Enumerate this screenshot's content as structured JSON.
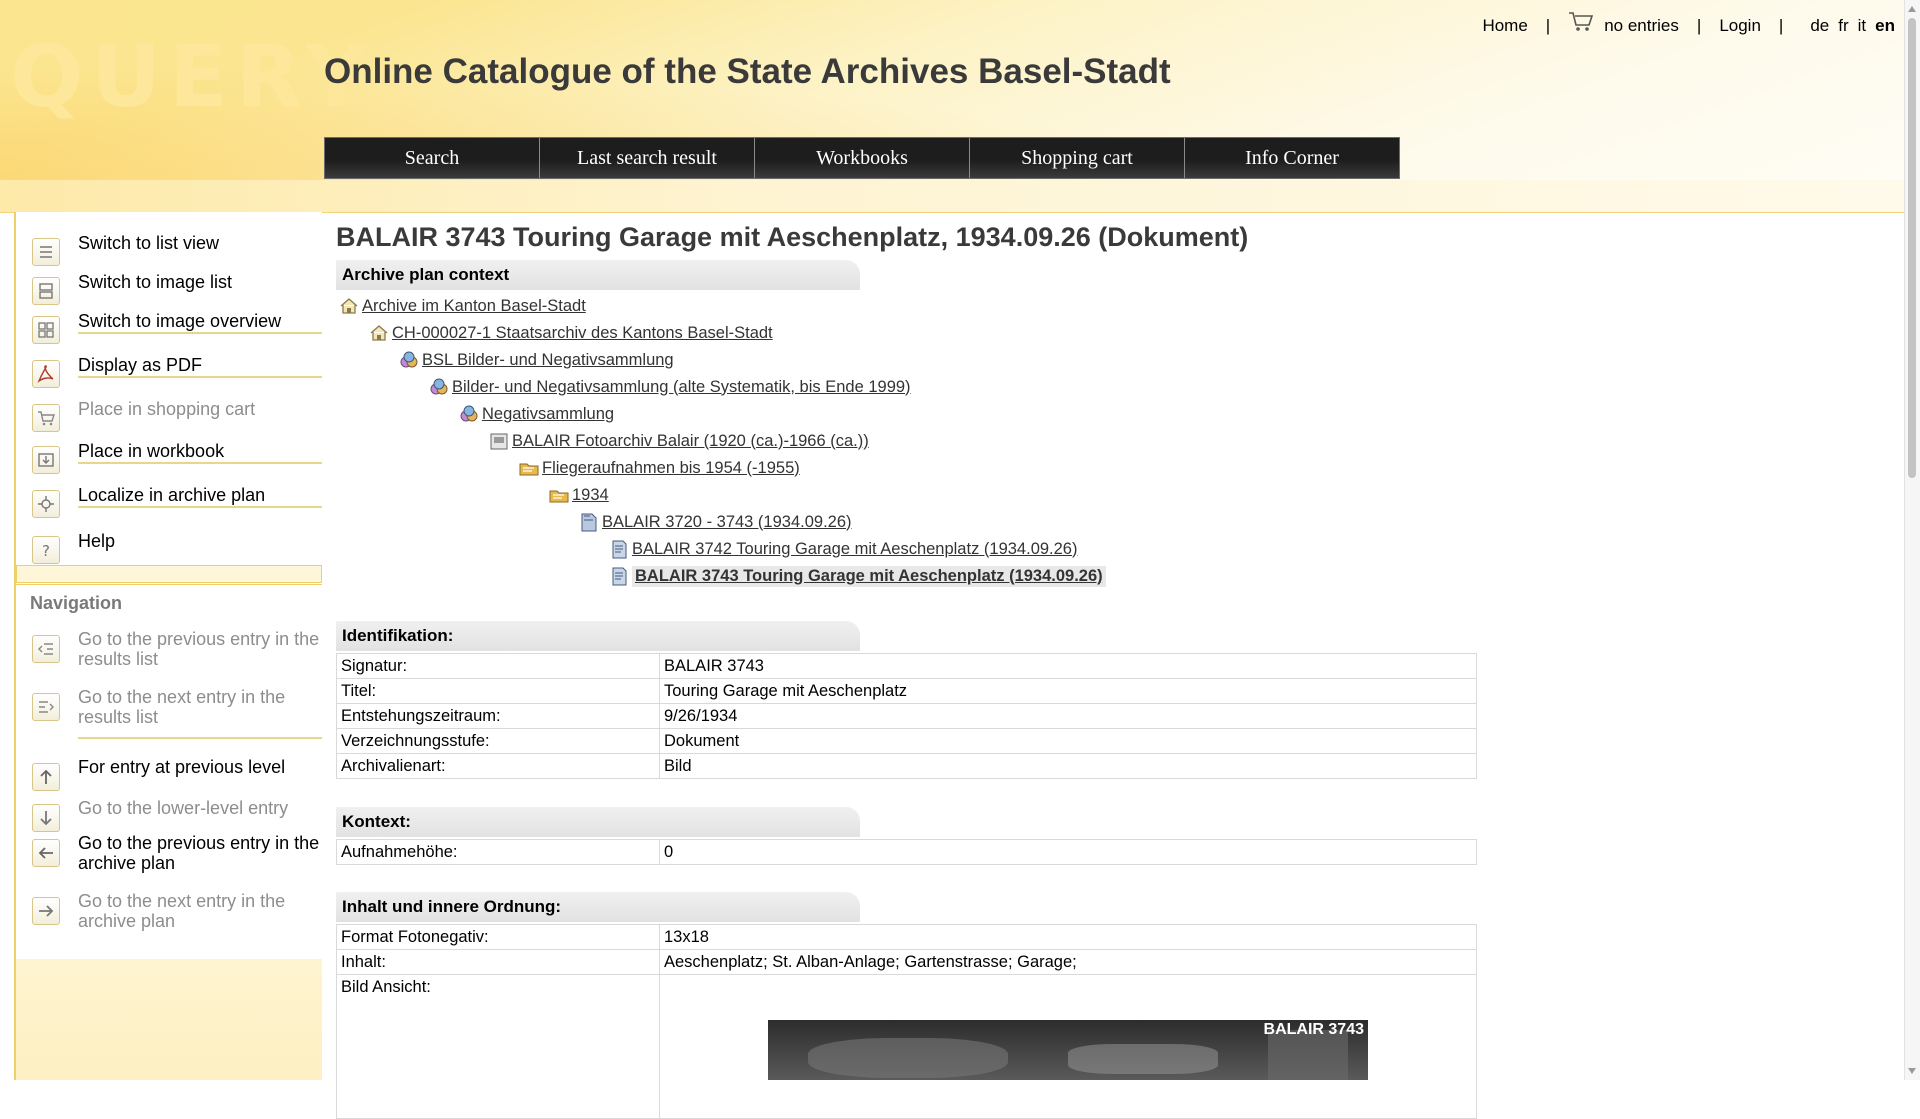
{
  "header": {
    "logo_text": "QUERY",
    "site_title": "Online Catalogue of the State Archives Basel-Stadt",
    "top_links": {
      "home": "Home",
      "separator": "|",
      "cart_status": "no entries",
      "login": "Login",
      "languages": [
        "de",
        "fr",
        "it",
        "en"
      ],
      "active_language": "en"
    },
    "nav_tabs": [
      "Search",
      "Last search result",
      "Workbooks",
      "Shopping cart",
      "Info Corner"
    ]
  },
  "sidebar": {
    "actions": [
      {
        "label": "Switch to list view",
        "icon": "list-view-icon",
        "enabled": true
      },
      {
        "label": "Switch to image list",
        "icon": "image-list-icon",
        "enabled": true
      },
      {
        "label": "Switch to image overview",
        "icon": "image-overview-icon",
        "enabled": true
      },
      {
        "label": "Display as PDF",
        "icon": "pdf-icon",
        "enabled": true
      },
      {
        "label": "Place in shopping cart",
        "icon": "cart-add-icon",
        "enabled": false
      },
      {
        "label": "Place in workbook",
        "icon": "workbook-add-icon",
        "enabled": true
      },
      {
        "label": "Localize in archive plan",
        "icon": "localize-icon",
        "enabled": true
      },
      {
        "label": "Help",
        "icon": "help-icon",
        "enabled": true
      }
    ],
    "navigation_heading": "Navigation",
    "navigation": [
      {
        "label": "Go to the previous entry in the results list",
        "icon": "prev-result-icon",
        "enabled": false
      },
      {
        "label": "Go to the next entry in the results list",
        "icon": "next-result-icon",
        "enabled": false
      },
      {
        "label": "For entry at previous level",
        "icon": "level-up-icon",
        "enabled": true
      },
      {
        "label": "Go to the lower-level entry",
        "icon": "level-down-icon",
        "enabled": false
      },
      {
        "label": "Go to the previous entry in the archive plan",
        "icon": "arrow-left-icon",
        "enabled": true
      },
      {
        "label": "Go to the next entry in the archive plan",
        "icon": "arrow-right-icon",
        "enabled": false
      }
    ]
  },
  "main": {
    "page_title": "BALAIR 3743 Touring Garage mit Aeschenplatz, 1934.09.26 (Dokument)",
    "archive_plan": {
      "heading": "Archive plan context",
      "items": [
        {
          "label": " Archive im Kanton Basel-Stadt",
          "icon": "house-icon",
          "level": 0
        },
        {
          "label": " CH-000027-1 Staatsarchiv des Kantons Basel-Stadt",
          "icon": "house-icon",
          "level": 1
        },
        {
          "label": " BSL Bilder- und Negativsammlung",
          "icon": "collection-icon",
          "level": 2
        },
        {
          "label": " Bilder- und Negativsammlung (alte Systematik, bis Ende 1999)",
          "icon": "collection-icon",
          "level": 3
        },
        {
          "label": " Negativsammlung",
          "icon": "collection-icon",
          "level": 4
        },
        {
          "label": " BALAIR Fotoarchiv Balair (1920 (ca.)-1966 (ca.))",
          "icon": "fonds-icon",
          "level": 5
        },
        {
          "label": " Fliegeraufnahmen bis 1954 (-1955)",
          "icon": "folder-icon",
          "level": 6
        },
        {
          "label": " 1934",
          "icon": "folder-icon",
          "level": 7
        },
        {
          "label": " BALAIR 3720 - 3743 (1934.09.26)",
          "icon": "dossier-icon",
          "level": 8
        },
        {
          "label": " BALAIR 3742 Touring Garage mit Aeschenplatz (1934.09.26)",
          "icon": "document-icon",
          "level": 9
        },
        {
          "label": " BALAIR 3743 Touring Garage mit Aeschenplatz (1934.09.26)",
          "icon": "document-icon",
          "level": 9,
          "current": true
        }
      ]
    },
    "identification": {
      "heading": "Identifikation:",
      "rows": [
        {
          "key": "Signatur:",
          "value": "BALAIR 3743"
        },
        {
          "key": "Titel:",
          "value": "Touring Garage mit Aeschenplatz"
        },
        {
          "key": "Entstehungszeitraum:",
          "value": "9/26/1934"
        },
        {
          "key": "Verzeichnungsstufe:",
          "value": "Dokument"
        },
        {
          "key": "Archivalienart:",
          "value": "Bild"
        }
      ]
    },
    "context": {
      "heading": "Kontext:",
      "rows": [
        {
          "key": "Aufnahmehöhe:",
          "value": "0"
        }
      ]
    },
    "content": {
      "heading": "Inhalt und innere Ordnung:",
      "rows": [
        {
          "key": "Format Fotonegativ:",
          "value": "13x18"
        },
        {
          "key": "Inhalt:",
          "value": "Aeschenplatz; St. Alban-Anlage; Gartenstrasse; Garage;"
        },
        {
          "key": "Bild Ansicht:",
          "value": ""
        }
      ],
      "image_caption": "BALAIR 3743"
    }
  }
}
